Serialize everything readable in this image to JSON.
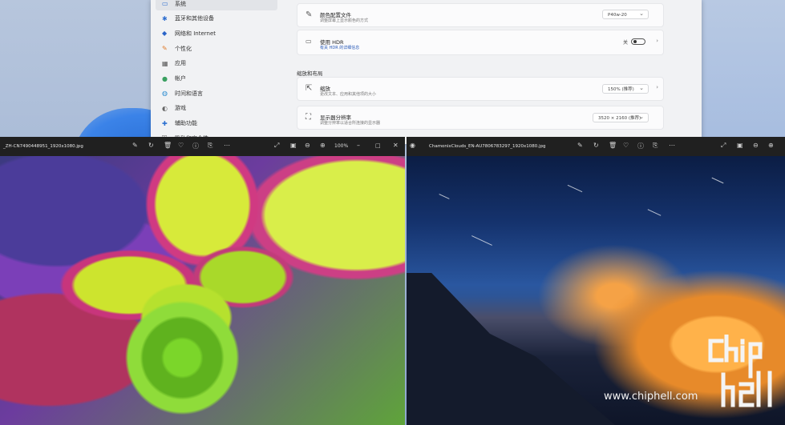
{
  "settings": {
    "nav": [
      {
        "label": "系统",
        "icon": "system-icon",
        "active": true
      },
      {
        "label": "蓝牙和其他设备",
        "icon": "bluetooth-icon"
      },
      {
        "label": "网络和 Internet",
        "icon": "wifi-icon"
      },
      {
        "label": "个性化",
        "icon": "brush-icon"
      },
      {
        "label": "应用",
        "icon": "apps-icon"
      },
      {
        "label": "帐户",
        "icon": "account-icon"
      },
      {
        "label": "时间和语言",
        "icon": "globe-icon"
      },
      {
        "label": "游戏",
        "icon": "gamepad-icon"
      },
      {
        "label": "辅助功能",
        "icon": "accessibility-icon"
      },
      {
        "label": "隐私和安全性",
        "icon": "shield-icon"
      }
    ],
    "color_profile": {
      "title": "颜色配置文件",
      "subtitle": "调整屏幕上显示颜色的方式",
      "value": "P40w-20"
    },
    "hdr": {
      "title": "使用 HDR",
      "subtitle": "有关 HDR 的详细信息",
      "toggle_label": "关"
    },
    "section_title": "缩放和布局",
    "scale": {
      "title": "缩放",
      "subtitle": "更改文本、应用和其他项的大小",
      "value": "150% (推荐)"
    },
    "resolution": {
      "title": "显示器分辨率",
      "subtitle": "调整分辨率以适合所连接的显示器",
      "value": "3520 × 2160 (推荐)"
    }
  },
  "viewer_left": {
    "filename": "_ZH-CN7490448951_1920x1080.jpg",
    "zoom": "100%"
  },
  "viewer_right": {
    "filename": "ChamonixClouds_EN-AU7806783297_1920x1080.jpg"
  },
  "watermark": {
    "url": "www.chiphell.com",
    "logo_text": "chiphell"
  }
}
